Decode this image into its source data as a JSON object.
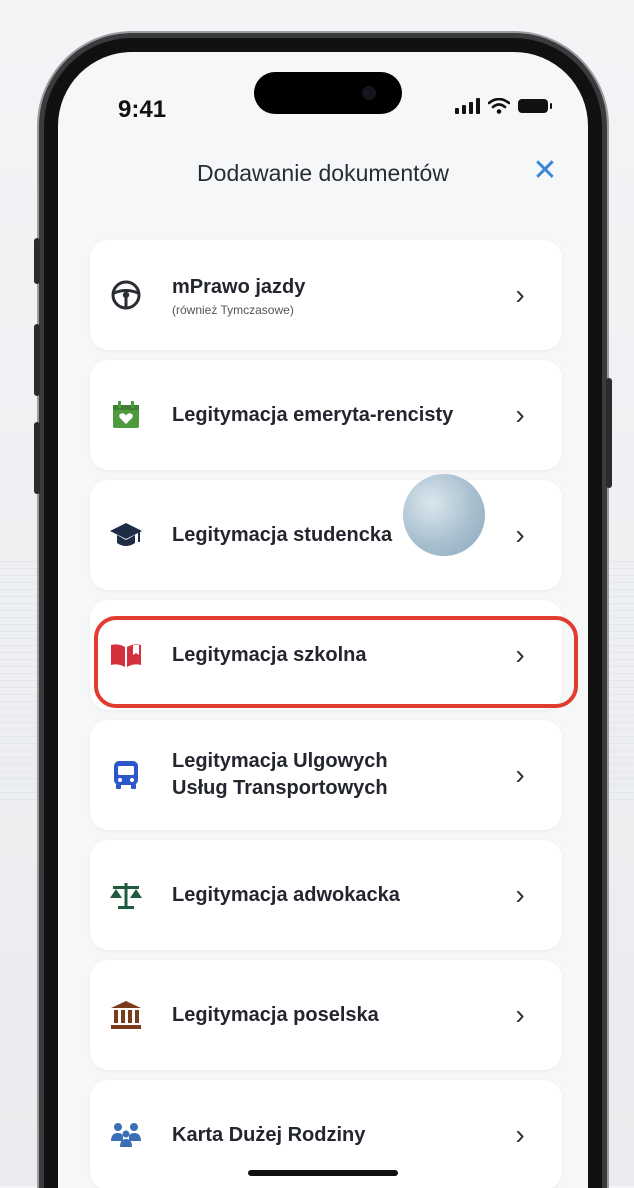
{
  "status_bar": {
    "time": "9:41"
  },
  "header": {
    "title": "Dodawanie dokumentów",
    "close_symbol": "✕"
  },
  "documents": [
    {
      "label": "mPrawo jazdy",
      "sublabel": "(również Tymczasowe)",
      "icon": "steering-wheel-icon",
      "color": "#2a2c33"
    },
    {
      "label": "Legitymacja emeryta-rencisty",
      "icon": "calendar-heart-icon",
      "color": "#4f9a3d"
    },
    {
      "label": "Legitymacja studencka",
      "icon": "graduation-cap-icon",
      "color": "#1f2c46"
    },
    {
      "label": "Legitymacja szkolna",
      "icon": "open-book-icon",
      "color": "#d4303d",
      "highlighted": true
    },
    {
      "label": "Legitymacja Ulgowych\nUsług Transportowych",
      "label_line1": "Legitymacja Ulgowych",
      "label_line2": "Usług Transportowych",
      "icon": "bus-icon",
      "color": "#2c56c9"
    },
    {
      "label": "Legitymacja adwokacka",
      "icon": "scales-icon",
      "color": "#1f5b3d"
    },
    {
      "label": "Legitymacja poselska",
      "icon": "parliament-building-icon",
      "color": "#7a3b1c"
    },
    {
      "label": "Karta Dużej Rodziny",
      "icon": "family-icon",
      "color": "#3a6fb6"
    }
  ],
  "chevron": "›",
  "highlight_color": "#e03c2f"
}
